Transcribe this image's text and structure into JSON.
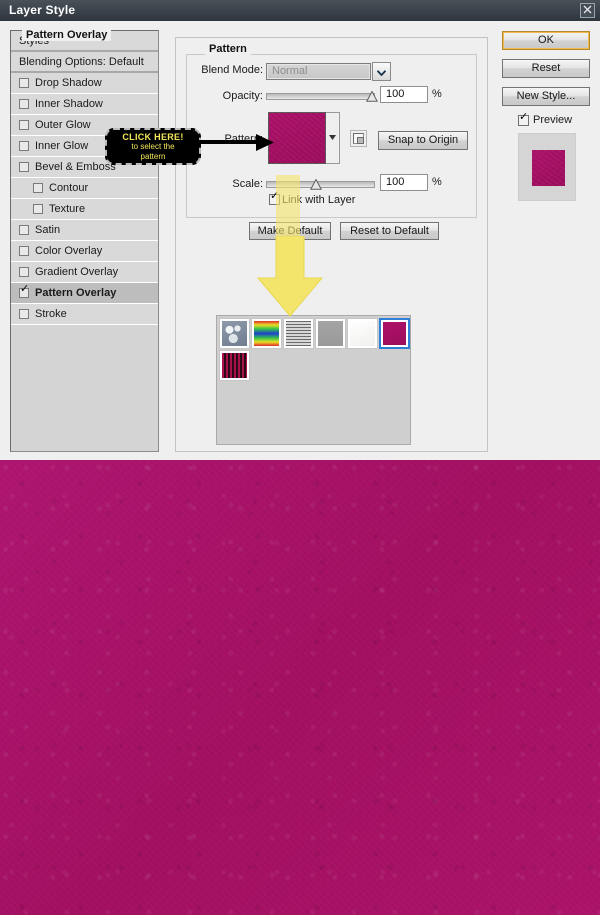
{
  "window": {
    "title": "Layer Style",
    "close_label": "✕"
  },
  "styles_panel": {
    "header": "Styles",
    "items": [
      {
        "label": "Blending Options: Default",
        "checkbox": false,
        "has_checkbox": false,
        "indent": false,
        "selected": false,
        "subheader": true
      },
      {
        "label": "Drop Shadow",
        "checkbox": false,
        "has_checkbox": true,
        "indent": false,
        "selected": false
      },
      {
        "label": "Inner Shadow",
        "checkbox": false,
        "has_checkbox": true,
        "indent": false,
        "selected": false
      },
      {
        "label": "Outer Glow",
        "checkbox": false,
        "has_checkbox": true,
        "indent": false,
        "selected": false
      },
      {
        "label": "Inner Glow",
        "checkbox": false,
        "has_checkbox": true,
        "indent": false,
        "selected": false
      },
      {
        "label": "Bevel & Emboss",
        "checkbox": false,
        "has_checkbox": true,
        "indent": false,
        "selected": false
      },
      {
        "label": "Contour",
        "checkbox": false,
        "has_checkbox": true,
        "indent": true,
        "selected": false
      },
      {
        "label": "Texture",
        "checkbox": false,
        "has_checkbox": true,
        "indent": true,
        "selected": false
      },
      {
        "label": "Satin",
        "checkbox": false,
        "has_checkbox": true,
        "indent": false,
        "selected": false
      },
      {
        "label": "Color Overlay",
        "checkbox": false,
        "has_checkbox": true,
        "indent": false,
        "selected": false
      },
      {
        "label": "Gradient Overlay",
        "checkbox": false,
        "has_checkbox": true,
        "indent": false,
        "selected": false
      },
      {
        "label": "Pattern Overlay",
        "checkbox": true,
        "has_checkbox": true,
        "indent": false,
        "selected": true
      },
      {
        "label": "Stroke",
        "checkbox": false,
        "has_checkbox": true,
        "indent": false,
        "selected": false
      }
    ]
  },
  "pattern_overlay": {
    "group_title": "Pattern Overlay",
    "pattern_group_title": "Pattern",
    "blend_mode": {
      "label": "Blend Mode:",
      "value": "Normal"
    },
    "opacity": {
      "label": "Opacity:",
      "value": "100",
      "unit": "%"
    },
    "pattern": {
      "label": "Pattern:",
      "snap_button": "Snap to Origin"
    },
    "scale": {
      "label": "Scale:",
      "value": "100",
      "unit": "%"
    },
    "link_with_layer": {
      "label": "Link with Layer",
      "checked": true
    },
    "make_default": "Make Default",
    "reset_to_default": "Reset to Default"
  },
  "picker": {
    "swatches": [
      {
        "name": "clouds-pattern",
        "selected": false
      },
      {
        "name": "rainbow-pattern",
        "selected": false
      },
      {
        "name": "text-lines-pattern",
        "selected": false
      },
      {
        "name": "gray-noise-pattern",
        "selected": false
      },
      {
        "name": "white-paper-pattern",
        "selected": false
      },
      {
        "name": "magenta-pattern",
        "selected": true
      },
      {
        "name": "red-stripes-pattern",
        "selected": false
      }
    ]
  },
  "right_buttons": {
    "ok": "OK",
    "reset": "Reset",
    "new_style": "New Style...",
    "preview": {
      "label": "Preview",
      "checked": true
    }
  },
  "annotations": {
    "callout_line1": "CLICK HERE!",
    "callout_line2": "to select the",
    "callout_line3": "pattern"
  },
  "colors": {
    "magenta": "#a8126a",
    "dialog_bg": "#efefef",
    "titlebar": "#39414a",
    "accent_ok": "#e0a33c",
    "selection_blue": "#2f7fd6",
    "callout_yellow": "#f2e85a"
  }
}
